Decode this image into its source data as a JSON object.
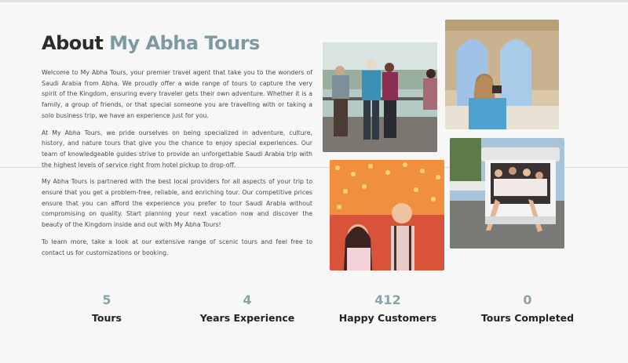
{
  "about": {
    "title_prefix": "About ",
    "title_accent": "My Abha Tours",
    "paragraphs": [
      "Welcome to My Abha Tours, your premier travel agent that take you to the wonders of Saudi Arabia from Abha. We proudly offer a wide range of tours to capture the very spirit of the Kingdom, ensuring every traveler gets their own adventure. Whether it is a family, a group of friends, or that special someone you are travelling with or taking a solo business trip, we have an experience just for you.",
      "At My Abha Tours, we pride ourselves on being specialized in adventure, culture, history, and nature tours that give you the chance to enjoy special experiences. Our team of knowledgeable guides strive to provide an unforgettable Saudi Arabia trip with the highest levels of service right from hotel pickup to drop-off.",
      "My Abha Tours is partnered with the best local providers for all aspects of your trip to ensure that you get a problem-free, reliable, and enriching tour. Our competitive prices ensure that you can afford the experience you prefer to tour Saudi Arabia without compromising on quality. Start planning your next vacation now and discover the beauty of the Kingdom inside and out with My Abha Tours!",
      "To learn more, take a look at our extensive range of scenic tours and feel free to contact us for customizations or booking."
    ]
  },
  "stats": [
    {
      "value": "5",
      "label": "Tours"
    },
    {
      "value": "4",
      "label": "Years Experience"
    },
    {
      "value": "412",
      "label": "Happy Customers"
    },
    {
      "value": "0",
      "label": "Tours Completed"
    }
  ],
  "colors": {
    "accent": "#7d9aa1",
    "stat_number": "#89a3aa",
    "background": "#f7f7f7"
  }
}
